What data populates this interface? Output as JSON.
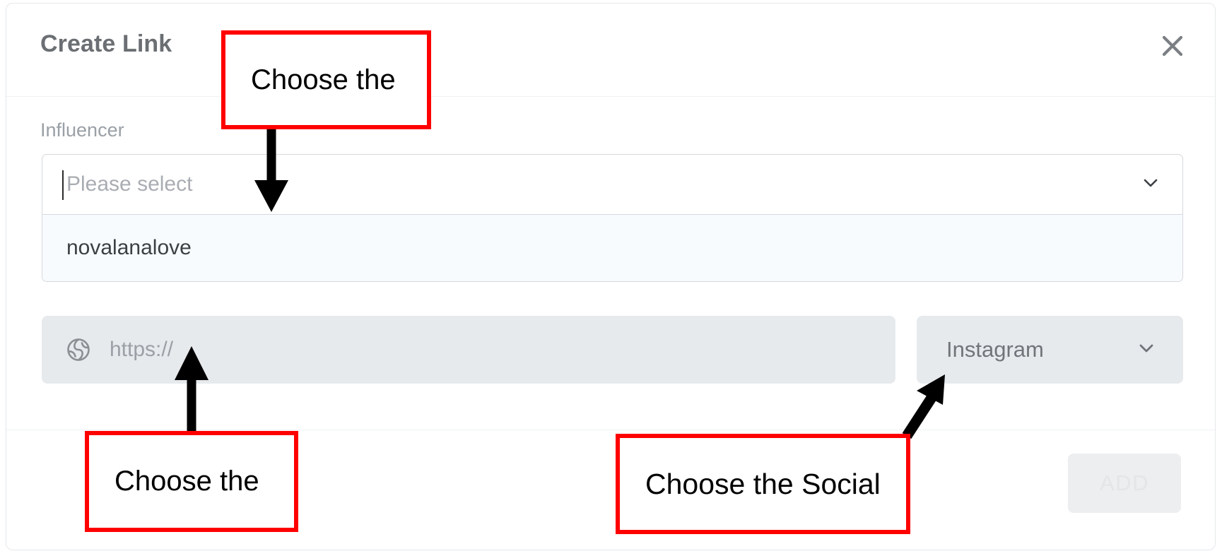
{
  "dialog": {
    "title": "Create Link",
    "close_icon": "close-icon"
  },
  "form": {
    "influencer": {
      "label": "Influencer",
      "placeholder": "Please select",
      "value": "",
      "chevron_icon": "chevron-down-icon",
      "menu_open": true,
      "options": [
        {
          "label": "novalanalove",
          "highlighted": true
        }
      ]
    },
    "url": {
      "placeholder": "https://",
      "value": "",
      "icon": "globe-icon"
    },
    "social": {
      "selected": "Instagram",
      "chevron_icon": "chevron-down-icon"
    }
  },
  "footer": {
    "add_label": "ADD",
    "add_disabled": true
  },
  "annotations": [
    {
      "id": "annotation-influencer",
      "text": "Choose the"
    },
    {
      "id": "annotation-url",
      "text": "Choose the"
    },
    {
      "id": "annotation-social",
      "text": "Choose the Social"
    }
  ],
  "colors": {
    "annotation_border": "#fe0000",
    "annotation_text": "#000000",
    "arrow": "#000000",
    "field_background": "#e7eaed",
    "option_highlight": "#f7fbfe",
    "title_text": "#6b6f73"
  }
}
